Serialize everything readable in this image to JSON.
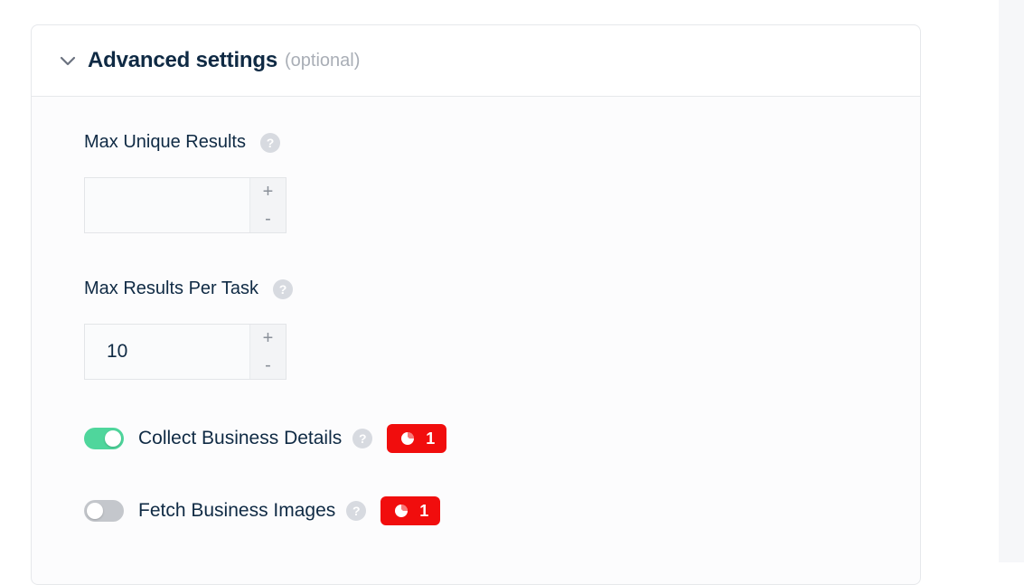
{
  "section": {
    "title": "Advanced settings",
    "optional_label": "(optional)"
  },
  "fields": [
    {
      "label": "Max Unique Results",
      "value": "",
      "plus": "+",
      "minus": "-"
    },
    {
      "label": "Max Results Per Task",
      "value": "10",
      "plus": "+",
      "minus": "-"
    }
  ],
  "toggles": [
    {
      "label": "Collect Business Details",
      "enabled": true,
      "badge_count": "1"
    },
    {
      "label": "Fetch Business Images",
      "enabled": false,
      "badge_count": "1"
    }
  ],
  "help_glyph": "?",
  "colors": {
    "toggle_on": "#4fd69c",
    "toggle_off": "#c4c7cc",
    "badge": "#f10d0d",
    "text": "#0f2a44"
  },
  "icons": [
    "chevron-down-icon",
    "help-icon",
    "credit-icon"
  ]
}
